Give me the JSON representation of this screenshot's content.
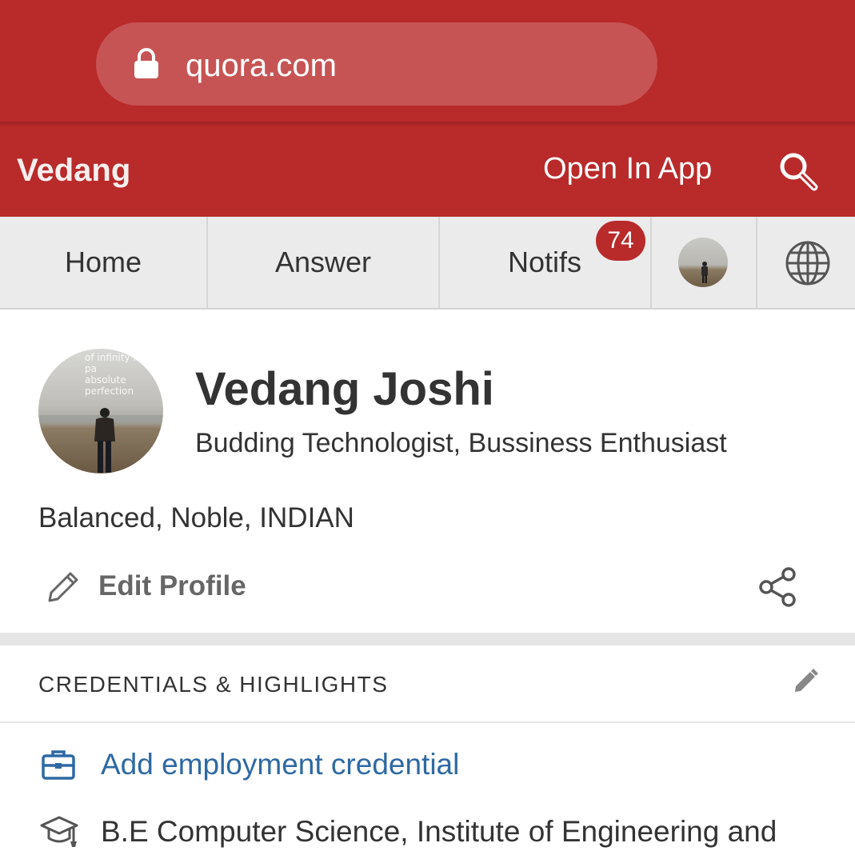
{
  "browser": {
    "url": "quora.com",
    "lock_icon": "lock-icon"
  },
  "header": {
    "brand": "Vedang",
    "open_in_app": "Open In App",
    "search_icon": "search-icon"
  },
  "nav": {
    "tabs": [
      {
        "label": "Home"
      },
      {
        "label": "Answer"
      },
      {
        "label": "Notifs"
      }
    ],
    "notif_count": "74",
    "avatar_icon": "profile-avatar",
    "language_icon": "globe-icon"
  },
  "profile": {
    "avatar_caption_lines": [
      "of infinity in the pa",
      "absolute perfection"
    ],
    "name": "Vedang Joshi",
    "headline": "Budding Technologist, Bussiness Enthusiast",
    "bio": "Balanced, Noble, INDIAN",
    "edit_label": "Edit Profile",
    "edit_icon": "pencil-icon",
    "share_icon": "share-icon"
  },
  "credentials": {
    "title": "CREDENTIALS & HIGHLIGHTS",
    "edit_icon": "pencil-icon",
    "items": [
      {
        "icon": "briefcase-icon",
        "label": "Add employment credential",
        "color": "#2e69a3"
      },
      {
        "icon": "graduation-cap-icon",
        "label": "B.E Computer Science, Institute of Engineering and"
      }
    ]
  },
  "colors": {
    "brand_red": "#b92a2a",
    "link_blue": "#2e69a3",
    "text_dark": "#333333",
    "nav_bg": "#ebebeb"
  }
}
